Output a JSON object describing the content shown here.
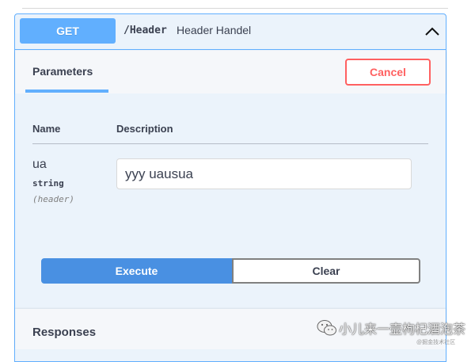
{
  "operation": {
    "method": "GET",
    "path": "/Header",
    "summary": "Header Handel",
    "collapse_icon": "chevron-up-icon"
  },
  "tabs": {
    "parameters_label": "Parameters",
    "cancel_label": "Cancel"
  },
  "parameters_table": {
    "headers": [
      "Name",
      "Description"
    ],
    "rows": [
      {
        "name": "ua",
        "type": "string",
        "location": "(header)",
        "value": "yyy  uausua"
      }
    ]
  },
  "actions": {
    "execute_label": "Execute",
    "clear_label": "Clear"
  },
  "responses": {
    "title": "Responses"
  },
  "watermark": {
    "text": "小儿来一壶枸杞酒泡茶",
    "subtext": "@掘金技术社区",
    "icon": "wechat-icon"
  },
  "colors": {
    "method_get": "#61affe",
    "cancel": "#ff6060",
    "execute": "#4990e2",
    "opblock_bg": "#ebf3fb"
  }
}
